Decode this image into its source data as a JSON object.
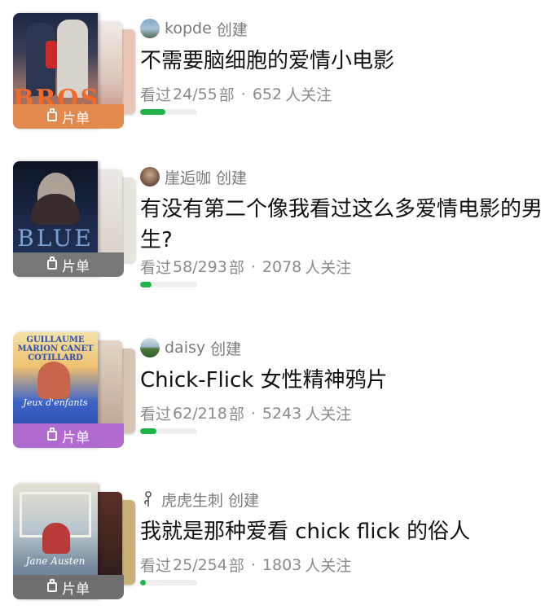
{
  "lists": [
    {
      "creator_name": "kopde",
      "creator_suffix": "创建",
      "title": "不需要脑细胞的爱情小电影",
      "watched_label": "看过",
      "watched": "24/55",
      "unit": "部",
      "separator": "·",
      "followers": "652",
      "followers_suffix": "人关注",
      "progress": 0.44,
      "badge_label": "片单",
      "poster_text": "BROS",
      "badge_color": "#e28a4e",
      "accent": "#e8703a"
    },
    {
      "creator_name": "崖逅咖",
      "creator_suffix": "创建",
      "title": "有没有第二个像我看过这么多爱情电影的男生?",
      "watched_label": "看过",
      "watched": "58/293",
      "unit": "部",
      "separator": "·",
      "followers": "2078",
      "followers_suffix": "人关注",
      "progress": 0.2,
      "badge_label": "片单",
      "poster_text": "BLUE",
      "badge_color": "#777777",
      "accent": "#1c2a4a"
    },
    {
      "creator_name": "daisy",
      "creator_suffix": "创建",
      "title": "Chick-Flick 女性精神鸦片",
      "watched_label": "看过",
      "watched": "62/218",
      "unit": "部",
      "separator": "·",
      "followers": "5243",
      "followers_suffix": "人关注",
      "progress": 0.28,
      "badge_label": "片单",
      "poster_text": "GUILLAUME MARION CANET COTILLARD",
      "poster_script": "Jeux d'enfants",
      "badge_color": "#b06ad0",
      "accent": "#2a4fb0"
    },
    {
      "creator_name": "虎虎生刺",
      "creator_suffix": "创建",
      "title": "我就是那种爱看 chick flick 的俗人",
      "watched_label": "看过",
      "watched": "25/254",
      "unit": "部",
      "separator": "·",
      "followers": "1803",
      "followers_suffix": "人关注",
      "progress": 0.1,
      "badge_label": "片单",
      "poster_script": "Jane Austen",
      "badge_color": "#6f6f6f",
      "accent": "#5a6f8a"
    }
  ]
}
